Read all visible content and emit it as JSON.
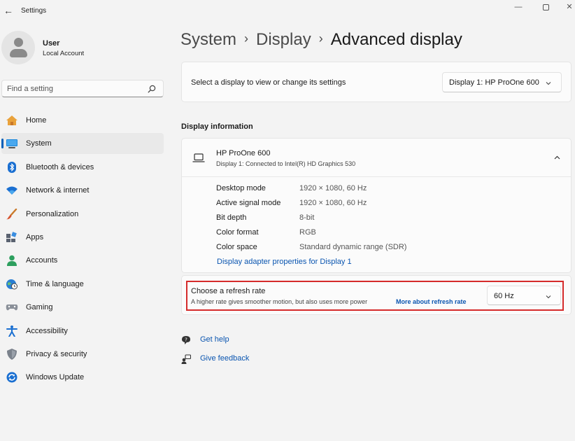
{
  "window": {
    "title": "Settings"
  },
  "user": {
    "name": "User",
    "account": "Local Account"
  },
  "search": {
    "placeholder": "Find a setting"
  },
  "sidebar": {
    "items": [
      {
        "label": "Home",
        "icon": "home-icon"
      },
      {
        "label": "System",
        "icon": "system-icon",
        "active": true
      },
      {
        "label": "Bluetooth & devices",
        "icon": "bluetooth-icon"
      },
      {
        "label": "Network & internet",
        "icon": "wifi-icon"
      },
      {
        "label": "Personalization",
        "icon": "brush-icon"
      },
      {
        "label": "Apps",
        "icon": "apps-icon"
      },
      {
        "label": "Accounts",
        "icon": "accounts-icon"
      },
      {
        "label": "Time & language",
        "icon": "globe-clock-icon"
      },
      {
        "label": "Gaming",
        "icon": "gamepad-icon"
      },
      {
        "label": "Accessibility",
        "icon": "accessibility-icon"
      },
      {
        "label": "Privacy & security",
        "icon": "shield-icon"
      },
      {
        "label": "Windows Update",
        "icon": "update-icon"
      }
    ]
  },
  "breadcrumb": {
    "part1": "System",
    "part2": "Display",
    "current": "Advanced display"
  },
  "display_select": {
    "label": "Select a display to view or change its settings",
    "value": "Display 1: HP ProOne 600"
  },
  "display_info": {
    "section_title": "Display information",
    "monitor_name": "HP ProOne 600",
    "monitor_sub": "Display 1: Connected to Intel(R) HD Graphics 530",
    "properties": [
      {
        "key": "Desktop mode",
        "value": "1920 × 1080, 60 Hz"
      },
      {
        "key": "Active signal mode",
        "value": "1920 × 1080, 60 Hz"
      },
      {
        "key": "Bit depth",
        "value": "8-bit"
      },
      {
        "key": "Color format",
        "value": "RGB"
      },
      {
        "key": "Color space",
        "value": "Standard dynamic range (SDR)"
      }
    ],
    "adapter_link": "Display adapter properties for Display 1"
  },
  "refresh": {
    "title": "Choose a refresh rate",
    "description": "A higher rate gives smoother motion, but also uses more power",
    "link": "More about refresh rate",
    "value": "60 Hz"
  },
  "help": {
    "get_help": "Get help",
    "give_feedback": "Give feedback"
  },
  "colors": {
    "accent": "#005fb8",
    "link": "#0a55b0",
    "highlight": "#d52b2b"
  }
}
